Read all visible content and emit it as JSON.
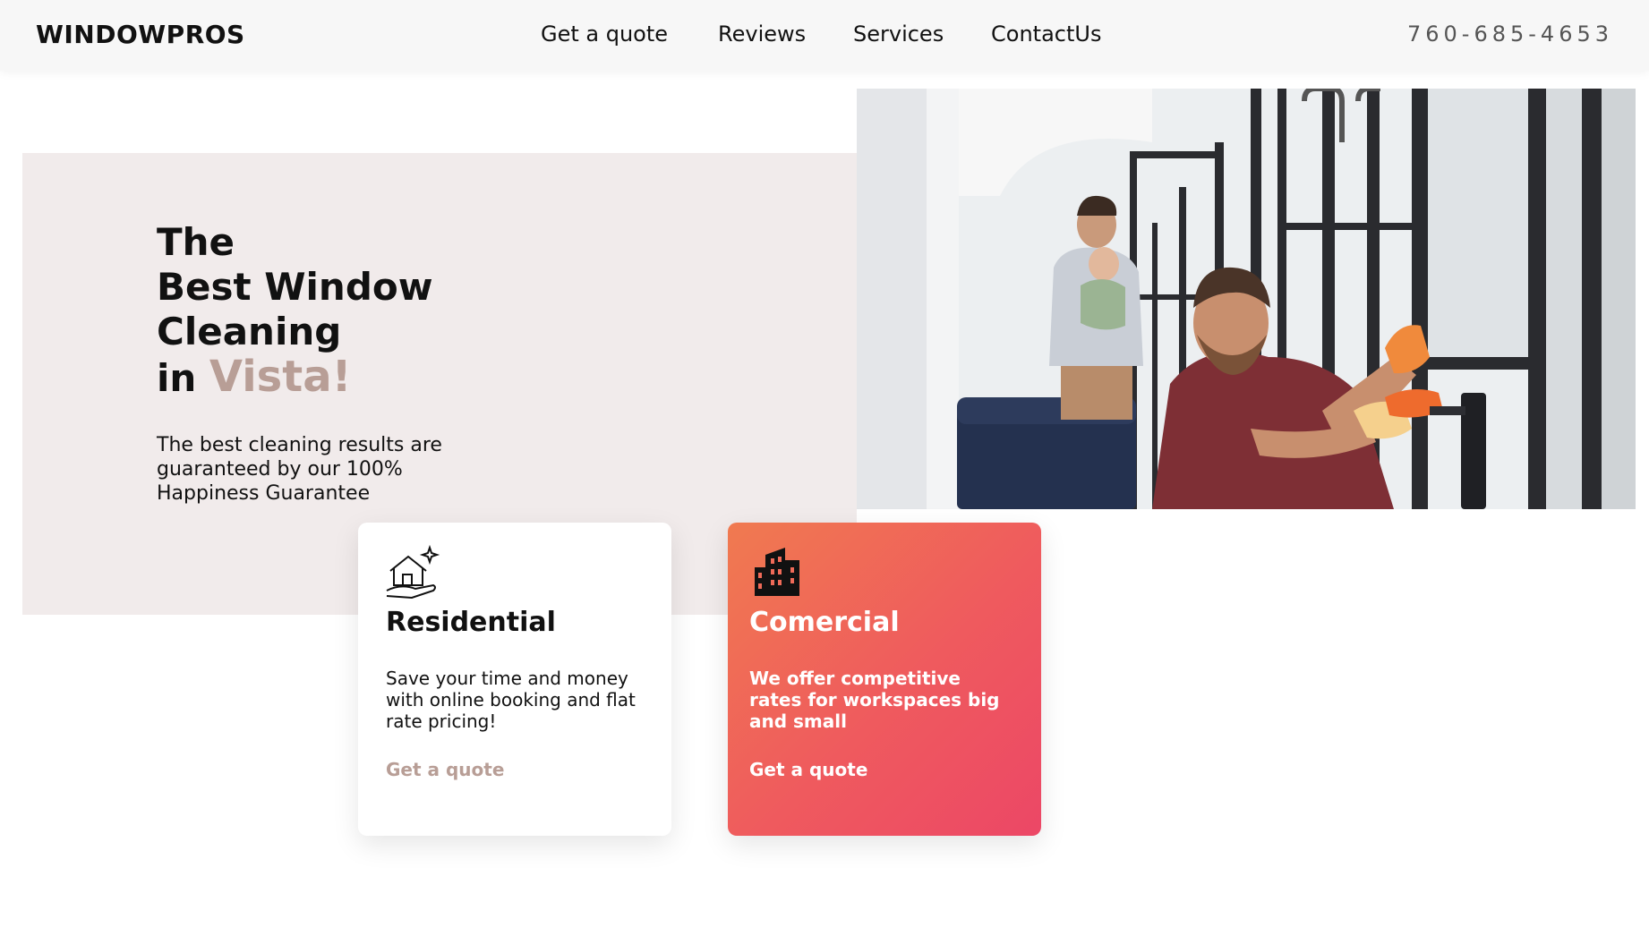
{
  "header": {
    "logo": "WINDOWPROS",
    "nav": [
      {
        "label": "Get a quote"
      },
      {
        "label": "Reviews"
      },
      {
        "label": "Services"
      },
      {
        "label": "ContactUs"
      }
    ],
    "phone": "760-685-4653"
  },
  "hero": {
    "title_line1": "The",
    "title_line2": "Best Window",
    "title_line3": "Cleaning",
    "title_line4_prefix": "in ",
    "title_accent": "Vista!",
    "subtitle": "The best cleaning results are guaranteed by our 100% Happiness Guarantee",
    "accent_color": "#b89e96"
  },
  "cards": {
    "residential": {
      "icon": "house-hand-sparkle-icon",
      "title": "Residential",
      "text": "Save your time and money with online booking and flat rate pricing!",
      "link": "Get a quote"
    },
    "commercial": {
      "icon": "buildings-icon",
      "title": "Comercial",
      "text": "We offer competitive rates for workspaces big and small",
      "link": "Get a quote"
    }
  }
}
